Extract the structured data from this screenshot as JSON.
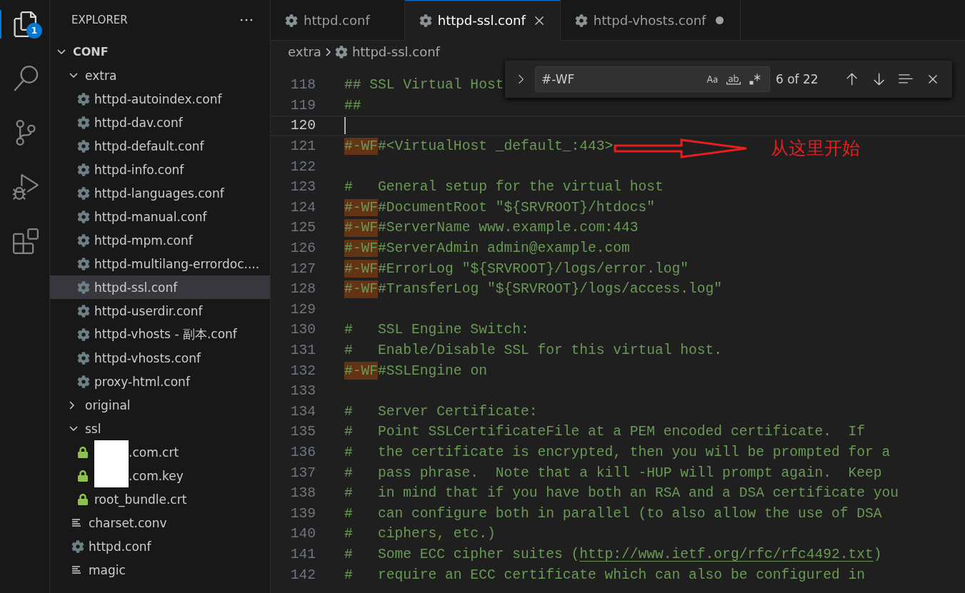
{
  "activity_bar": {
    "items": [
      {
        "kind": "explorer",
        "selected": true,
        "badge": "1"
      },
      {
        "kind": "search",
        "selected": false
      },
      {
        "kind": "source_control",
        "selected": false
      },
      {
        "kind": "run_debug",
        "selected": false
      },
      {
        "kind": "extensions",
        "selected": false
      }
    ]
  },
  "sidebar": {
    "title": "EXPLORER",
    "tree": [
      {
        "kind": "folder",
        "label": "CONF",
        "expanded": true,
        "selected": false,
        "children": [
          {
            "kind": "folder",
            "label": "extra",
            "expanded": true,
            "selected": false,
            "children": [
              {
                "kind": "gear",
                "label": "httpd-autoindex.conf",
                "selected": false
              },
              {
                "kind": "gear",
                "label": "httpd-dav.conf",
                "selected": false
              },
              {
                "kind": "gear",
                "label": "httpd-default.conf",
                "selected": false
              },
              {
                "kind": "gear",
                "label": "httpd-info.conf",
                "selected": false
              },
              {
                "kind": "gear",
                "label": "httpd-languages.conf",
                "selected": false
              },
              {
                "kind": "gear",
                "label": "httpd-manual.conf",
                "selected": false
              },
              {
                "kind": "gear",
                "label": "httpd-mpm.conf",
                "selected": false
              },
              {
                "kind": "gear",
                "label": "httpd-multilang-errordoc....",
                "selected": false
              },
              {
                "kind": "gear",
                "label": "httpd-ssl.conf",
                "selected": true
              },
              {
                "kind": "gear",
                "label": "httpd-userdir.conf",
                "selected": false
              },
              {
                "kind": "gear",
                "label": "httpd-vhosts - 副本.conf",
                "selected": false
              },
              {
                "kind": "gear",
                "label": "httpd-vhosts.conf",
                "selected": false
              },
              {
                "kind": "gear",
                "label": "proxy-html.conf",
                "selected": false
              }
            ]
          },
          {
            "kind": "folder",
            "label": "original",
            "expanded": false,
            "selected": false
          },
          {
            "kind": "folder",
            "label": "ssl",
            "expanded": true,
            "selected": false,
            "children": [
              {
                "kind": "lock",
                "label": ".com.crt",
                "selected": false,
                "redacted": true
              },
              {
                "kind": "lock",
                "label": ".com.key",
                "selected": false,
                "redacted": true
              },
              {
                "kind": "lock",
                "label": "root_bundle.crt",
                "selected": false,
                "redacted": false
              }
            ]
          },
          {
            "kind": "text",
            "label": "charset.conv",
            "selected": false
          },
          {
            "kind": "gear",
            "label": "httpd.conf",
            "selected": false
          },
          {
            "kind": "text",
            "label": "magic",
            "selected": false
          }
        ]
      }
    ]
  },
  "tabs": [
    {
      "label": "httpd.conf",
      "selected": false,
      "dirty": false
    },
    {
      "label": "httpd-ssl.conf",
      "selected": true,
      "dirty": false
    },
    {
      "label": "httpd-vhosts.conf",
      "selected": false,
      "dirty": true
    }
  ],
  "breadcrumb": [
    {
      "kind": "folder",
      "label": "extra"
    },
    {
      "kind": "gear",
      "label": "httpd-ssl.conf"
    }
  ],
  "find": {
    "query": "#-WF",
    "result": "6 of 22",
    "match_case": false,
    "whole_word": false,
    "regex": false
  },
  "annotation": {
    "text": "从这里开始"
  },
  "lines": [
    {
      "number": "118",
      "current": false,
      "segments": [
        {
          "kind": "comment",
          "text": "## SSL Virtual Host"
        }
      ]
    },
    {
      "number": "119",
      "current": false,
      "segments": [
        {
          "kind": "comment",
          "text": "##"
        }
      ]
    },
    {
      "number": "120",
      "current": true
    },
    {
      "number": "121",
      "current": false,
      "segments": [
        {
          "kind": "match",
          "text": "#-WF"
        },
        {
          "kind": "comment",
          "text": "#<VirtualHost _default_:443>"
        }
      ]
    },
    {
      "number": "122",
      "current": false
    },
    {
      "number": "123",
      "current": false,
      "segments": [
        {
          "kind": "comment",
          "text": "#   General setup for the virtual host"
        }
      ]
    },
    {
      "number": "124",
      "current": false,
      "segments": [
        {
          "kind": "match",
          "text": "#-WF"
        },
        {
          "kind": "comment",
          "text": "#DocumentRoot \"${SRVROOT}/htdocs\""
        }
      ]
    },
    {
      "number": "125",
      "current": false,
      "segments": [
        {
          "kind": "match",
          "text": "#-WF"
        },
        {
          "kind": "comment",
          "text": "#ServerName www.example.com:443"
        }
      ]
    },
    {
      "number": "126",
      "current": false,
      "segments": [
        {
          "kind": "match",
          "text": "#-WF"
        },
        {
          "kind": "comment",
          "text": "#ServerAdmin admin@example.com"
        }
      ]
    },
    {
      "number": "127",
      "current": false,
      "segments": [
        {
          "kind": "match",
          "text": "#-WF"
        },
        {
          "kind": "comment",
          "text": "#ErrorLog \"${SRVROOT}/logs/error.log\""
        }
      ]
    },
    {
      "number": "128",
      "current": false,
      "segments": [
        {
          "kind": "match",
          "text": "#-WF"
        },
        {
          "kind": "comment",
          "text": "#TransferLog \"${SRVROOT}/logs/access.log\""
        }
      ]
    },
    {
      "number": "129",
      "current": false
    },
    {
      "number": "130",
      "current": false,
      "segments": [
        {
          "kind": "comment",
          "text": "#   SSL Engine Switch:"
        }
      ]
    },
    {
      "number": "131",
      "current": false,
      "segments": [
        {
          "kind": "comment",
          "text": "#   Enable/Disable SSL for this virtual host."
        }
      ]
    },
    {
      "number": "132",
      "current": false,
      "segments": [
        {
          "kind": "match",
          "text": "#-WF"
        },
        {
          "kind": "comment",
          "text": "#SSLEngine on"
        }
      ]
    },
    {
      "number": "133",
      "current": false
    },
    {
      "number": "134",
      "current": false,
      "segments": [
        {
          "kind": "comment",
          "text": "#   Server Certificate:"
        }
      ]
    },
    {
      "number": "135",
      "current": false,
      "segments": [
        {
          "kind": "comment",
          "text": "#   Point SSLCertificateFile at a PEM encoded certificate.  If"
        }
      ]
    },
    {
      "number": "136",
      "current": false,
      "segments": [
        {
          "kind": "comment",
          "text": "#   the certificate is encrypted, then you will be prompted for a"
        }
      ]
    },
    {
      "number": "137",
      "current": false,
      "segments": [
        {
          "kind": "comment",
          "text": "#   pass phrase.  Note that a kill -HUP will prompt again.  Keep"
        }
      ]
    },
    {
      "number": "138",
      "current": false,
      "segments": [
        {
          "kind": "comment",
          "text": "#   in mind that if you have both an RSA and a DSA certificate you"
        }
      ]
    },
    {
      "number": "139",
      "current": false,
      "segments": [
        {
          "kind": "comment",
          "text": "#   can configure both in parallel (to also allow the use of DSA"
        }
      ]
    },
    {
      "number": "140",
      "current": false,
      "segments": [
        {
          "kind": "comment",
          "text": "#   ciphers, etc.)"
        }
      ]
    },
    {
      "number": "141",
      "current": false,
      "segments": [
        {
          "kind": "comment",
          "text": "#   Some ECC cipher suites ("
        },
        {
          "kind": "link",
          "text": "http://www.ietf.org/rfc/rfc4492.txt"
        },
        {
          "kind": "comment",
          "text": ")"
        }
      ]
    },
    {
      "number": "142",
      "current": false,
      "segments": [
        {
          "kind": "comment",
          "text": "#   require an ECC certificate which can also be configured in"
        }
      ]
    }
  ]
}
